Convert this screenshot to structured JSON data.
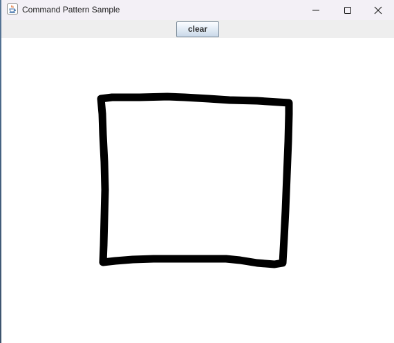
{
  "window": {
    "title": "Command Pattern Sample",
    "app_icon": "java-cup-icon"
  },
  "caption_buttons": {
    "minimize_icon": "minimize-icon",
    "maximize_icon": "maximize-icon",
    "close_icon": "close-icon"
  },
  "toolbar": {
    "clear_label": "clear"
  },
  "canvas": {
    "stroke_color": "#000000",
    "drawing": "hand-drawn-square"
  }
}
